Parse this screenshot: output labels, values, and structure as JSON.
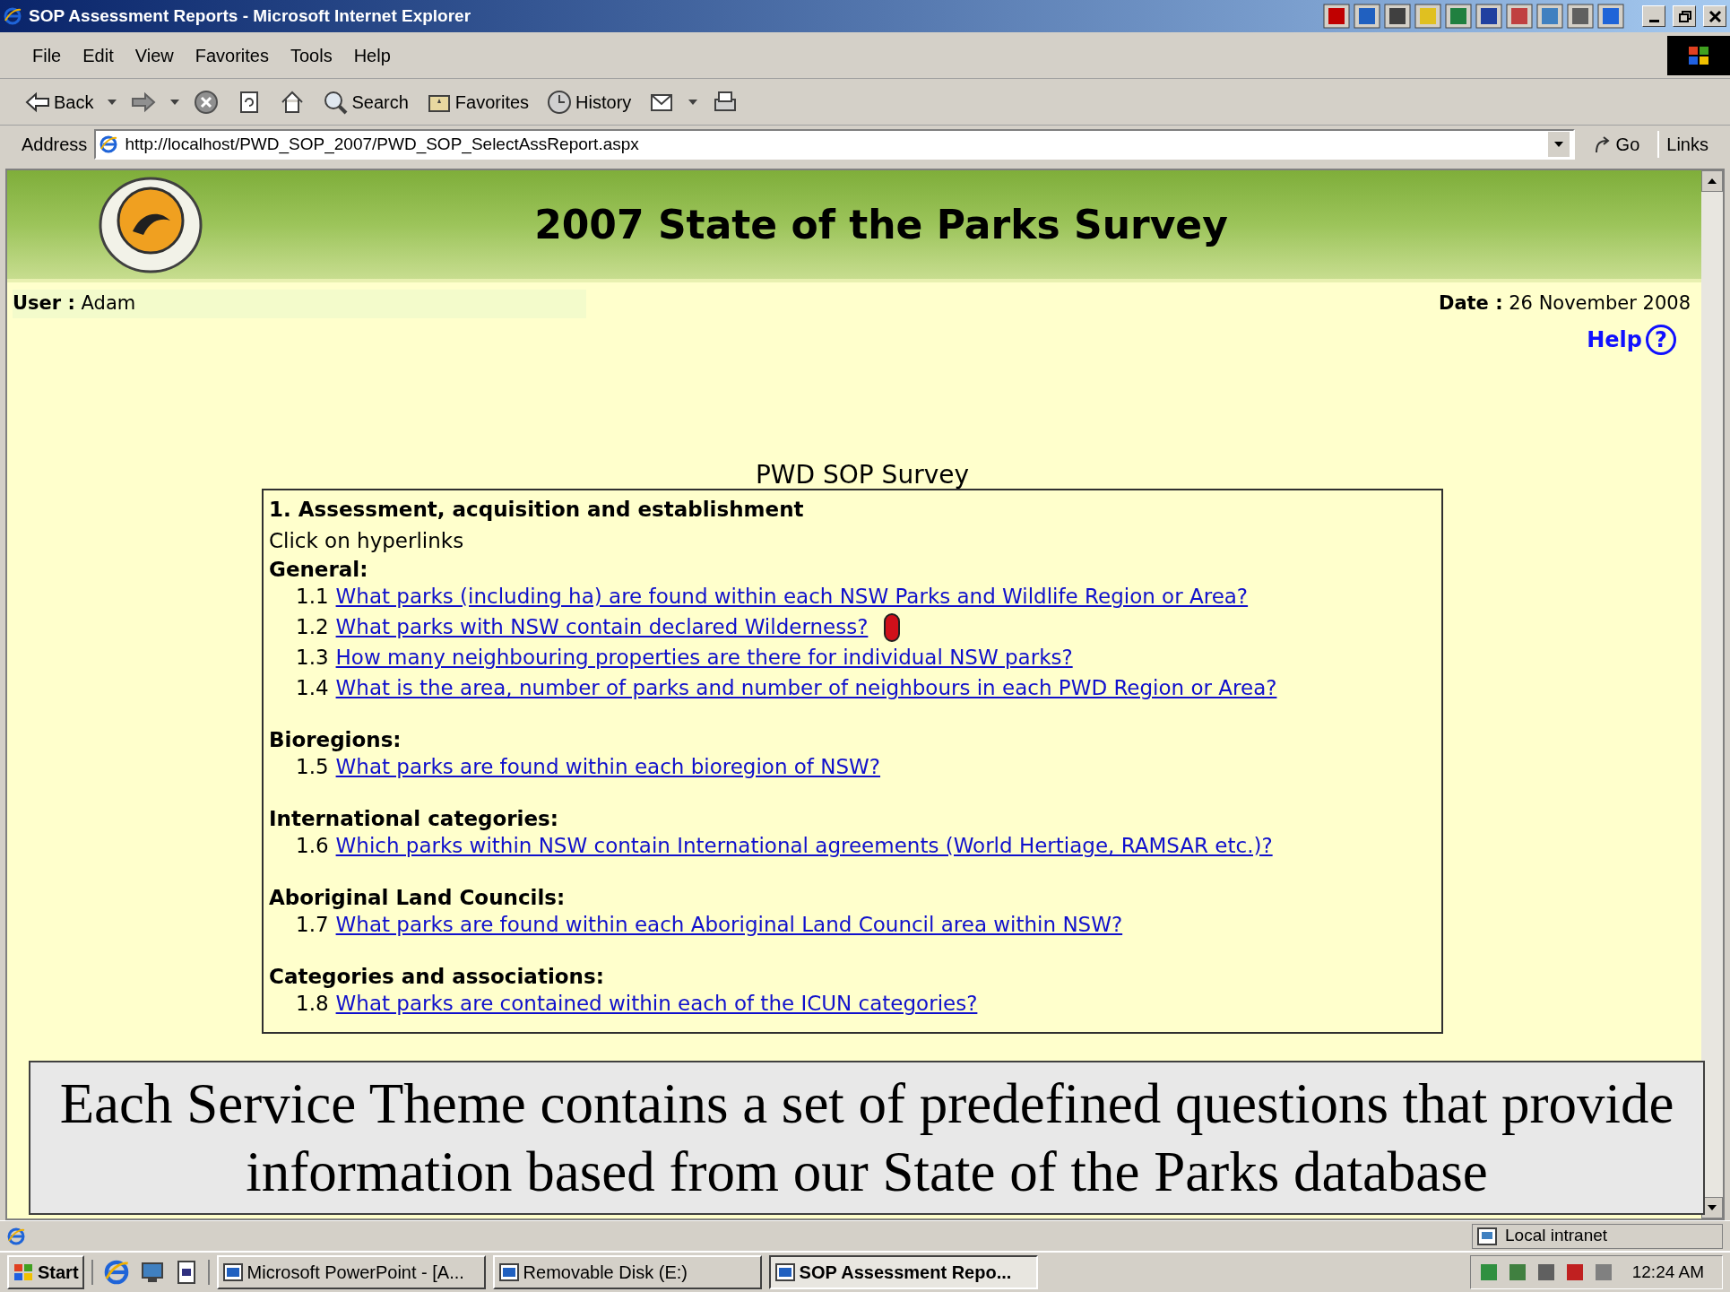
{
  "window": {
    "title": "SOP Assessment Reports - Microsoft Internet Explorer"
  },
  "menu": [
    "File",
    "Edit",
    "View",
    "Favorites",
    "Tools",
    "Help"
  ],
  "toolbar": [
    {
      "kind": "back",
      "label": "Back"
    },
    {
      "kind": "forward"
    },
    {
      "kind": "stop"
    },
    {
      "kind": "refresh"
    },
    {
      "kind": "home"
    },
    {
      "kind": "search",
      "label": "Search"
    },
    {
      "kind": "favorites",
      "label": "Favorites"
    },
    {
      "kind": "history",
      "label": "History"
    },
    {
      "kind": "mail"
    },
    {
      "kind": "print"
    }
  ],
  "address": {
    "label": "Address",
    "value": "http://localhost/PWD_SOP_2007/PWD_SOP_SelectAssReport.aspx",
    "go": "Go",
    "links": "Links"
  },
  "page": {
    "banner_title": "2007 State of the Parks Survey",
    "user_label": "User :",
    "user": "Adam",
    "date_label": "Date :",
    "date": "26 November 2008",
    "help": "Help",
    "help_icon": "?",
    "survey_title": "PWD SOP Survey",
    "section_title": "1. Assessment, acquisition and establishment",
    "instruction": "Click on hyperlinks",
    "groups": [
      {
        "heading": "General:",
        "items": [
          {
            "number": "1.1",
            "text": "What parks (including ha) are found within each NSW Parks and Wildlife Region or Area?",
            "marked": false
          },
          {
            "number": "1.2",
            "text": "What parks with NSW contain declared Wilderness?",
            "marked": true
          },
          {
            "number": "1.3",
            "text": "How many neighbouring properties are there for individual NSW parks?",
            "marked": false
          },
          {
            "number": "1.4",
            "text": "What is the area, number of parks and number of neighbours in each PWD Region or Area?",
            "marked": false
          }
        ]
      },
      {
        "heading": "Bioregions:",
        "items": [
          {
            "number": "1.5",
            "text": "What parks are found within each bioregion of NSW?",
            "marked": false
          }
        ]
      },
      {
        "heading": "International categories:",
        "items": [
          {
            "number": "1.6",
            "text": "Which parks within NSW contain International agreements (World Hertiage, RAMSAR etc.)?",
            "marked": false
          }
        ]
      },
      {
        "heading": "Aboriginal Land Councils:",
        "items": [
          {
            "number": "1.7",
            "text": "What parks are found within each Aboriginal Land Council area within NSW?",
            "marked": false
          }
        ]
      },
      {
        "heading": "Categories and associations:",
        "items": [
          {
            "number": "1.8",
            "text": "What parks are contained within each of the ICUN categories?",
            "marked": false
          }
        ]
      }
    ]
  },
  "caption": [
    "Each Service Theme contains a set of predefined questions that provide",
    "information based from our State of the Parks database"
  ],
  "status_bar": {
    "zone": "Local intranet"
  },
  "taskbar": {
    "start": "Start",
    "tasks": [
      {
        "label": "Microsoft PowerPoint - [A...",
        "selected": false
      },
      {
        "label": "Removable Disk (E:)",
        "selected": false
      },
      {
        "label": "SOP Assessment Repo...",
        "selected": true
      }
    ],
    "clock": "12:24 AM"
  }
}
